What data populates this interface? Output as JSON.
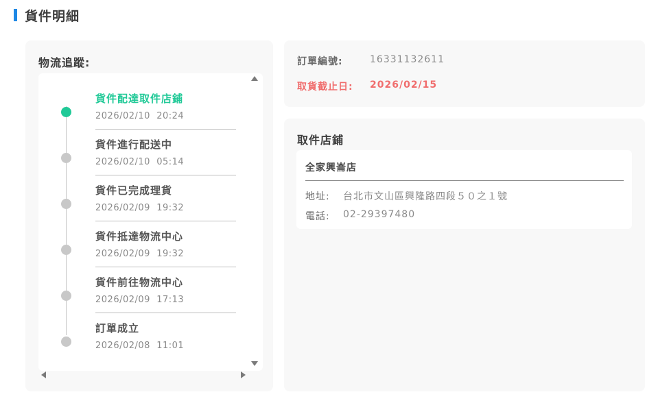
{
  "section": {
    "title": "貨件明細"
  },
  "tracking": {
    "label": "物流追蹤:",
    "events": [
      {
        "title": "貨件配達取件店鋪",
        "time": "2026/02/10  20:24",
        "active": true
      },
      {
        "title": "貨件進行配送中",
        "time": "2026/02/10  05:14",
        "active": false
      },
      {
        "title": "貨件已完成理貨",
        "time": "2026/02/09  19:32",
        "active": false
      },
      {
        "title": "貨件抵達物流中心",
        "time": "2026/02/09  19:32",
        "active": false
      },
      {
        "title": "貨件前往物流中心",
        "time": "2026/02/09  17:13",
        "active": false
      },
      {
        "title": "訂單成立",
        "time": "2026/02/08  11:01",
        "active": false
      }
    ]
  },
  "order": {
    "number_label": "訂單編號:",
    "number_value": "16331132611",
    "deadline_label": "取貨截止日:",
    "deadline_value": "2026/02/15"
  },
  "store": {
    "title": "取件店鋪",
    "name": "全家興崙店",
    "address_label": "地址:",
    "address_value": "台北市文山區興隆路四段５０之１號",
    "phone_label": "電話:",
    "phone_value": "02-29397480"
  },
  "colors": {
    "accent": "#1e88e5",
    "active_status": "#20c997",
    "deadline": "#f06d6d",
    "inactive_dot": "#c8c8c8"
  }
}
